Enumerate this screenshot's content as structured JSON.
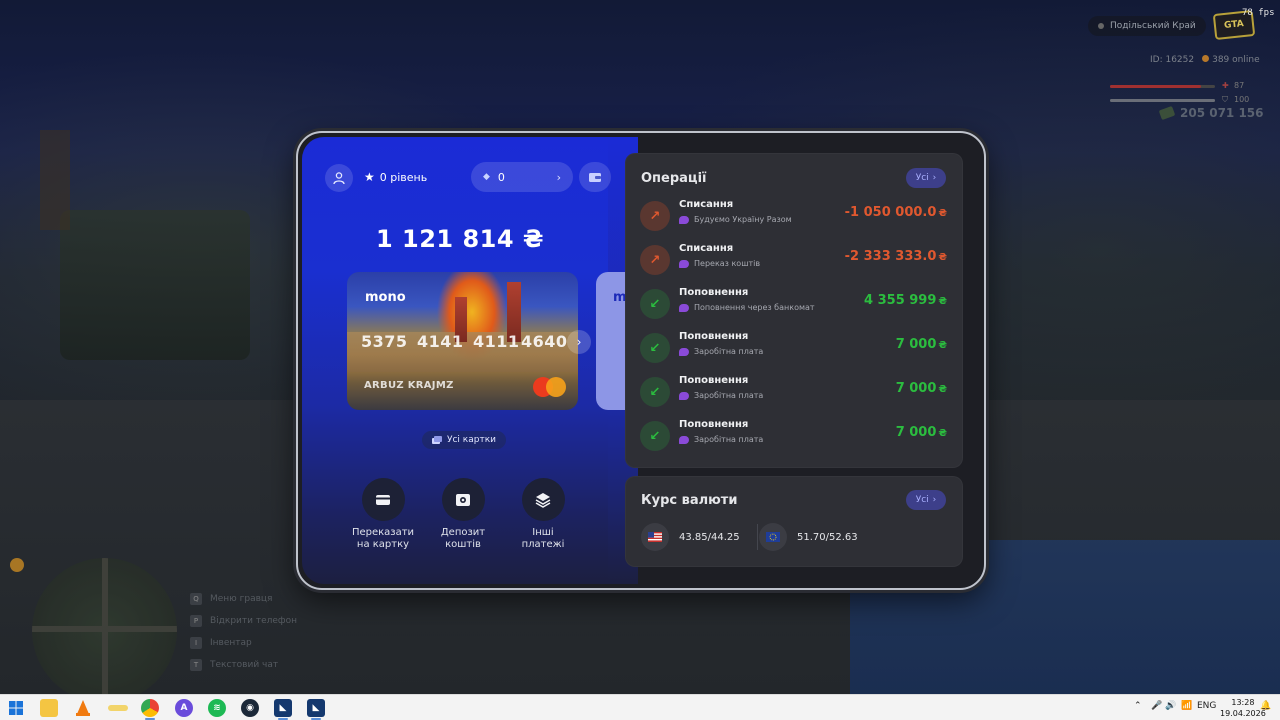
{
  "hud": {
    "server_name": "Подільський Край",
    "fps": "78 fps",
    "logo_text": "GTA",
    "id_label": "ID: 16252",
    "online": "389 online",
    "health_value": "87",
    "armor_value": "100",
    "health_fraction": 0.87,
    "armor_fraction": 1.0,
    "money": "205 071 156",
    "key_hints": [
      {
        "key": "Q",
        "label": "Меню гравця"
      },
      {
        "key": "P",
        "label": "Відкрити телефон"
      },
      {
        "key": "I",
        "label": "Інвентар"
      },
      {
        "key": "T",
        "label": "Текстовий чат"
      }
    ]
  },
  "colors": {
    "accent_blue": "#1b2bd6",
    "expense": "#e0582f",
    "income": "#2bbd3f",
    "panel": "#2e2f35"
  },
  "bank": {
    "level": "0 рівень",
    "coins": "0",
    "balance": "1 121 814 ₴",
    "card": {
      "brand": "mono",
      "number_groups": [
        "5375",
        "4141",
        "4111",
        "4640"
      ],
      "holder": "ARBUZ KRAJMZ",
      "network_icon": "mastercard-icon"
    },
    "next_card_brand": "mo",
    "all_cards_label": "Усі картки",
    "actions": [
      {
        "label_line1": "Переказати",
        "label_line2": "на картку",
        "icon": "card-icon"
      },
      {
        "label_line1": "Депозит",
        "label_line2": "коштів",
        "icon": "safe-icon"
      },
      {
        "label_line1": "Інші",
        "label_line2": "платежі",
        "icon": "layers-icon"
      }
    ]
  },
  "operations": {
    "title": "Операції",
    "all_label": "Усі",
    "items": [
      {
        "type": "Списання",
        "desc": "Будуємо Україну Разом",
        "amount": "-1 050 000.0",
        "currency": "₴",
        "direction": "out"
      },
      {
        "type": "Списання",
        "desc": "Переказ коштів",
        "amount": "-2 333 333.0",
        "currency": "₴",
        "direction": "out"
      },
      {
        "type": "Поповнення",
        "desc": "Поповнення через банкомат",
        "amount": "4 355 999",
        "currency": "₴",
        "direction": "in"
      },
      {
        "type": "Поповнення",
        "desc": "Заробітна плата",
        "amount": "7 000",
        "currency": "₴",
        "direction": "in"
      },
      {
        "type": "Поповнення",
        "desc": "Заробітна плата",
        "amount": "7 000",
        "currency": "₴",
        "direction": "in"
      },
      {
        "type": "Поповнення",
        "desc": "Заробітна плата",
        "amount": "7 000",
        "currency": "₴",
        "direction": "in"
      }
    ]
  },
  "rates": {
    "title": "Курс валюти",
    "all_label": "Усі",
    "usd": "43.85/44.25",
    "eur": "51.70/52.63"
  },
  "taskbar": {
    "lang": "ENG",
    "time": "13:28",
    "date": "19.04.2026"
  }
}
